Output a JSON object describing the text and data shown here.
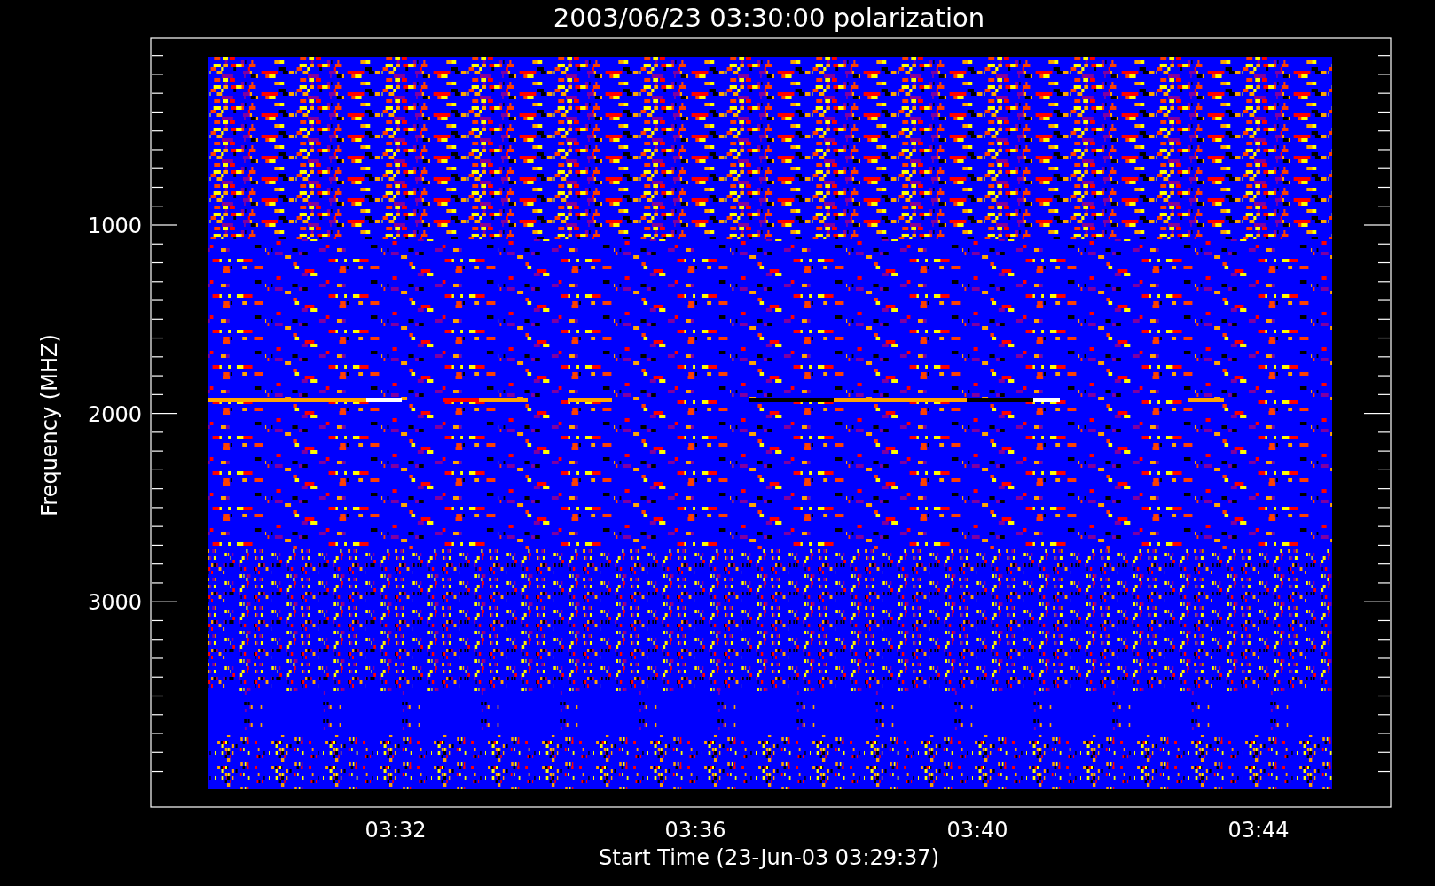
{
  "plot": {
    "title": "2003/06/23 03:30:00 polarization",
    "ylabel": "Frequency (MHZ)",
    "xlabel": "Start Time (23-Jun-03 03:29:37)",
    "yticks": [
      "1000",
      "2000",
      "3000"
    ],
    "xticks": [
      "03:32",
      "03:36",
      "03:40",
      "03:44"
    ]
  }
}
